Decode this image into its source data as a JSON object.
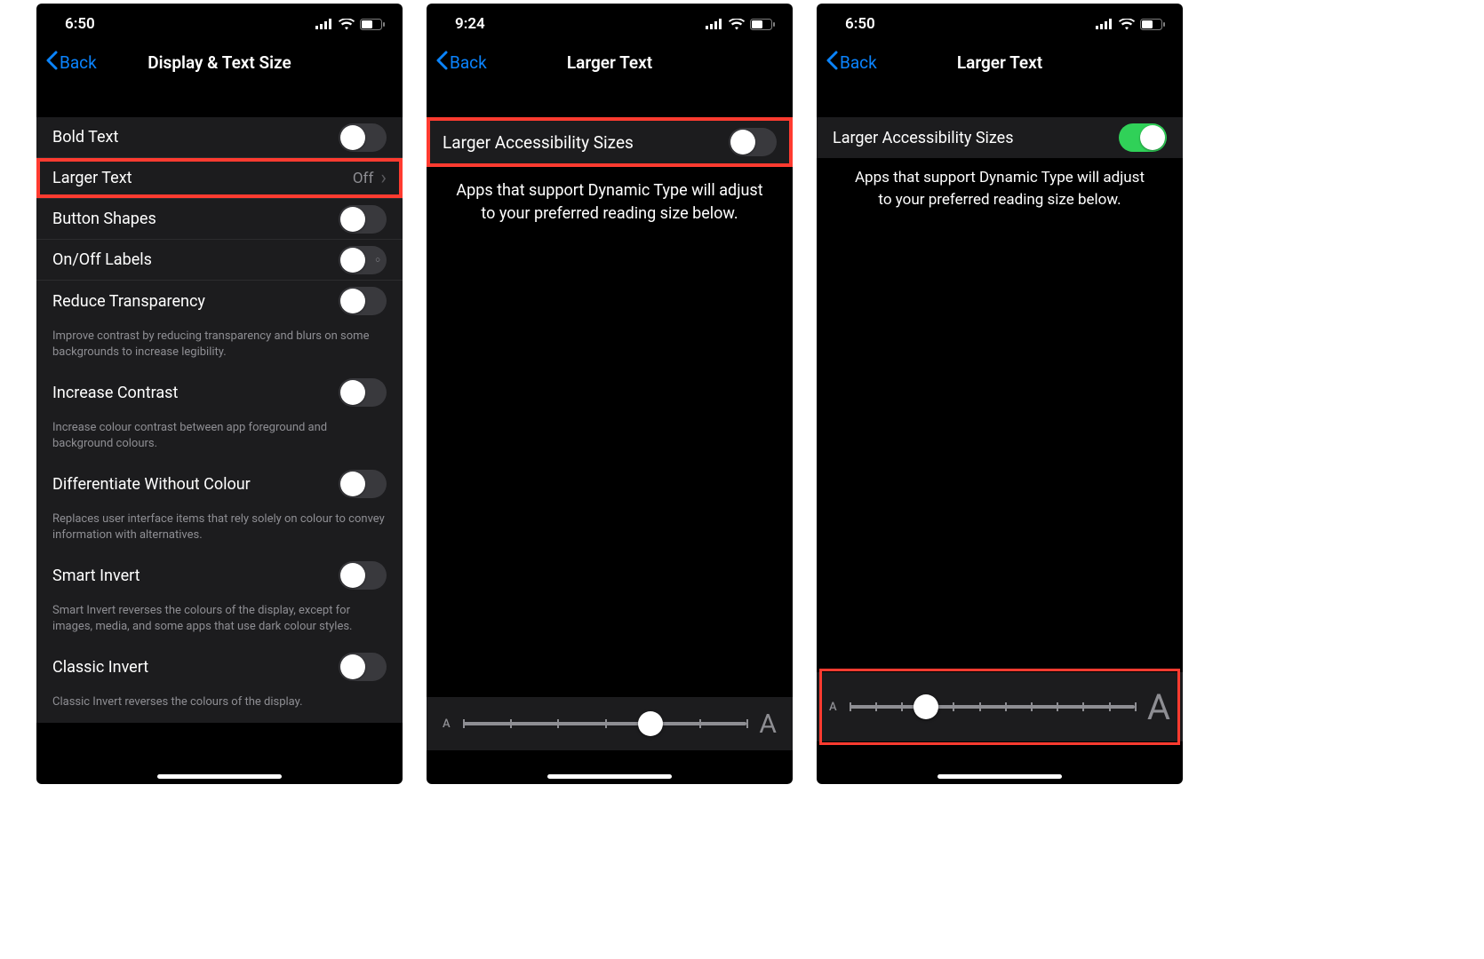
{
  "colors": {
    "accent": "#0a84ff",
    "toggle_on": "#30d158",
    "highlight": "#ff3b30",
    "cell_bg": "#1c1c1e",
    "secondary_text": "#8e8e93"
  },
  "phone1": {
    "time": "6:50",
    "back": "Back",
    "title": "Display & Text Size",
    "rows": {
      "bold_text": "Bold Text",
      "larger_text": "Larger Text",
      "larger_text_value": "Off",
      "button_shapes": "Button Shapes",
      "onoff_labels": "On/Off Labels",
      "reduce_transparency": "Reduce Transparency",
      "reduce_transparency_footer": "Improve contrast by reducing transparency and blurs on some backgrounds to increase legibility.",
      "increase_contrast": "Increase Contrast",
      "increase_contrast_footer": "Increase colour contrast between app foreground and background colours.",
      "diff_without_colour": "Differentiate Without Colour",
      "diff_without_colour_footer": "Replaces user interface items that rely solely on colour to convey information with alternatives.",
      "smart_invert": "Smart Invert",
      "smart_invert_footer": "Smart Invert reverses the colours of the display, except for images, media, and some apps that use dark colour styles.",
      "classic_invert": "Classic Invert",
      "classic_invert_footer": "Classic Invert reverses the colours of the display."
    }
  },
  "phone2": {
    "time": "9:24",
    "back": "Back",
    "title": "Larger Text",
    "toggle_label": "Larger Accessibility Sizes",
    "toggle_state": "off",
    "description": "Apps that support Dynamic Type will adjust to your preferred reading size below.",
    "slider": {
      "ticks": 7,
      "position_pct": 66
    }
  },
  "phone3": {
    "time": "6:50",
    "back": "Back",
    "title": "Larger Text",
    "toggle_label": "Larger Accessibility Sizes",
    "toggle_state": "on",
    "description": "Apps that support Dynamic Type will adjust to your preferred reading size below.",
    "slider": {
      "ticks": 12,
      "position_pct": 27
    }
  },
  "glyphs": {
    "small_a": "A",
    "large_a": "A"
  }
}
